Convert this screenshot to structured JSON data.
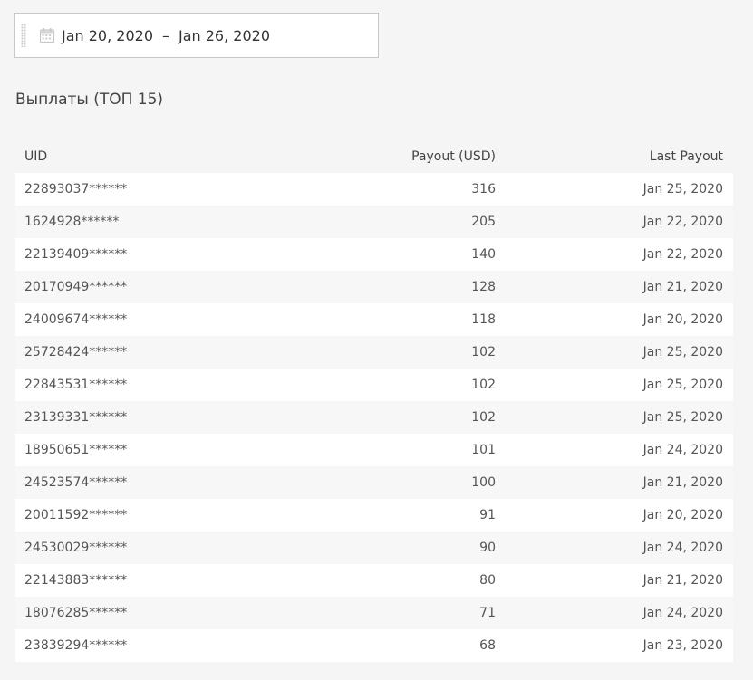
{
  "date_range": {
    "start": "Jan 20, 2020",
    "separator": "–",
    "end": "Jan 26, 2020",
    "icon": "calendar-icon"
  },
  "section": {
    "title": "Выплаты (ТОП 15)"
  },
  "table": {
    "headers": {
      "uid": "UID",
      "payout": "Payout (USD)",
      "last_payout": "Last Payout"
    },
    "rows": [
      {
        "uid": "22893037******",
        "payout": "316",
        "last": "Jan 25, 2020"
      },
      {
        "uid": "1624928******",
        "payout": "205",
        "last": "Jan 22, 2020"
      },
      {
        "uid": "22139409******",
        "payout": "140",
        "last": "Jan 22, 2020"
      },
      {
        "uid": "20170949******",
        "payout": "128",
        "last": "Jan 21, 2020"
      },
      {
        "uid": "24009674******",
        "payout": "118",
        "last": "Jan 20, 2020"
      },
      {
        "uid": "25728424******",
        "payout": "102",
        "last": "Jan 25, 2020"
      },
      {
        "uid": "22843531******",
        "payout": "102",
        "last": "Jan 25, 2020"
      },
      {
        "uid": "23139331******",
        "payout": "102",
        "last": "Jan 25, 2020"
      },
      {
        "uid": "18950651******",
        "payout": "101",
        "last": "Jan 24, 2020"
      },
      {
        "uid": "24523574******",
        "payout": "100",
        "last": "Jan 21, 2020"
      },
      {
        "uid": "20011592******",
        "payout": "91",
        "last": "Jan 20, 2020"
      },
      {
        "uid": "24530029******",
        "payout": "90",
        "last": "Jan 24, 2020"
      },
      {
        "uid": "22143883******",
        "payout": "80",
        "last": "Jan 21, 2020"
      },
      {
        "uid": "18076285******",
        "payout": "71",
        "last": "Jan 24, 2020"
      },
      {
        "uid": "23839294******",
        "payout": "68",
        "last": "Jan 23, 2020"
      }
    ]
  },
  "colors": {
    "background": "#f5f5f5",
    "row_odd": "#ffffff",
    "row_even": "#f7f7f7",
    "text": "#555555"
  }
}
